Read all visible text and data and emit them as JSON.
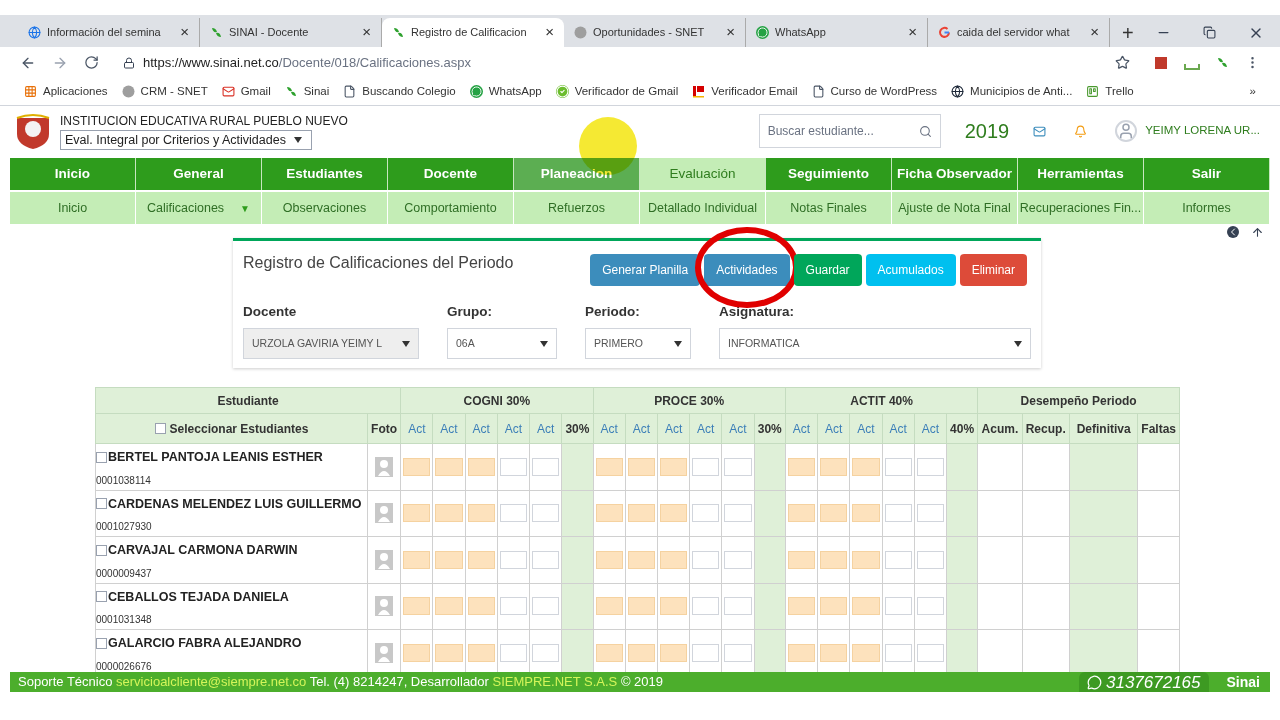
{
  "browser": {
    "tabs": [
      {
        "title": "Información del semina",
        "kind": "globe",
        "close": "×",
        "selected": false
      },
      {
        "title": "SINAI - Docente",
        "kind": "leaf",
        "close": "×",
        "selected": false
      },
      {
        "title": "Registro de Calificacion",
        "kind": "leaf",
        "close": "×",
        "selected": true
      },
      {
        "title": "Oportunidades - SNET",
        "kind": "snet",
        "close": "×",
        "selected": false
      },
      {
        "title": "WhatsApp",
        "kind": "whatsapp",
        "close": "×",
        "selected": false
      },
      {
        "title": "caida del servidor what",
        "kind": "google",
        "close": "×",
        "selected": false
      }
    ],
    "new_tab": "+",
    "url_host": "https://www.sinai.net.co",
    "url_path": "/Docente/018/Calificaciones.aspx",
    "bookmarks": [
      {
        "label": "Aplicaciones",
        "kind": "apps"
      },
      {
        "label": "CRM - SNET",
        "kind": "snet"
      },
      {
        "label": "Gmail",
        "kind": "gmail"
      },
      {
        "label": "Sinai",
        "kind": "leaf"
      },
      {
        "label": "Buscando Colegio",
        "kind": "page"
      },
      {
        "label": "WhatsApp",
        "kind": "whatsapp"
      },
      {
        "label": "Verificador de Gmail",
        "kind": "check"
      },
      {
        "label": "Verificador Email",
        "kind": "flag"
      },
      {
        "label": "Curso de WordPress",
        "kind": "page"
      },
      {
        "label": "Municipios de Anti...",
        "kind": "wiki"
      },
      {
        "label": "Trello",
        "kind": "board"
      }
    ],
    "more": "»"
  },
  "header": {
    "school": "INSTITUCION EDUCATIVA RURAL PUEBLO NUEVO",
    "evaluation_select": "Eval. Integral por Criterios y Actividades",
    "search_placeholder": "Buscar estudiante...",
    "year": "2019",
    "user": "YEIMY LORENA UR..."
  },
  "nav": [
    {
      "label": "Inicio",
      "selected": false,
      "pointer": false
    },
    {
      "label": "General",
      "selected": false,
      "pointer": false
    },
    {
      "label": "Estudiantes",
      "selected": false,
      "pointer": false
    },
    {
      "label": "Docente",
      "selected": false,
      "pointer": false
    },
    {
      "label": "Planeacion",
      "selected": false,
      "pointer": true
    },
    {
      "label": "Evaluación",
      "selected": true,
      "pointer": false
    },
    {
      "label": "Seguimiento",
      "selected": false,
      "pointer": false
    },
    {
      "label": "Ficha Observador",
      "selected": false,
      "pointer": false
    },
    {
      "label": "Herramientas",
      "selected": false,
      "pointer": false
    },
    {
      "label": "Salir",
      "selected": false,
      "pointer": false
    }
  ],
  "subnav": [
    {
      "label": "Inicio"
    },
    {
      "label": "Calificaciones",
      "caret": "▼"
    },
    {
      "label": "Observaciones"
    },
    {
      "label": "Comportamiento"
    },
    {
      "label": "Refuerzos"
    },
    {
      "label": "Detallado Individual"
    },
    {
      "label": "Notas Finales"
    },
    {
      "label": "Ajuste de Nota Final"
    },
    {
      "label": "Recuperaciones Fin..."
    },
    {
      "label": "Informes"
    }
  ],
  "form": {
    "title": "Registro de Calificaciones del Periodo",
    "buttons": [
      {
        "label": "Generar Planilla",
        "color": "#3c8dbc",
        "circled": false
      },
      {
        "label": "Actividades",
        "color": "#3c8dbc",
        "circled": true
      },
      {
        "label": "Guardar",
        "color": "#00a65a",
        "circled": false
      },
      {
        "label": "Acumulados",
        "color": "#00c0ef",
        "circled": false
      },
      {
        "label": "Eliminar",
        "color": "#dd4b39",
        "circled": false
      }
    ],
    "fields": [
      {
        "label": "Docente",
        "value": "URZOLA GAVIRIA YEIMY L",
        "disabled": true
      },
      {
        "label": "Grupo:",
        "value": "06A",
        "disabled": false
      },
      {
        "label": "Periodo:",
        "value": "PRIMERO",
        "disabled": false
      },
      {
        "label": "Asignatura:",
        "value": "INFORMATICA",
        "disabled": false
      }
    ]
  },
  "table": {
    "student_header": "Estudiante",
    "select_all": {
      "label": "Seleccionar Estudiantes",
      "checked": false
    },
    "photo_header": "Foto",
    "groups": [
      {
        "title": "COGNI 30%",
        "percent": "30%",
        "acts": [
          {
            "label": "Act",
            "filled": true
          },
          {
            "label": "Act",
            "filled": true
          },
          {
            "label": "Act",
            "filled": true
          },
          {
            "label": "Act",
            "filled": false
          },
          {
            "label": "Act",
            "filled": false
          }
        ]
      },
      {
        "title": "PROCE 30%",
        "percent": "30%",
        "acts": [
          {
            "label": "Act",
            "filled": true
          },
          {
            "label": "Act",
            "filled": true
          },
          {
            "label": "Act",
            "filled": true
          },
          {
            "label": "Act",
            "filled": false
          },
          {
            "label": "Act",
            "filled": false
          }
        ]
      },
      {
        "title": "ACTIT 40%",
        "percent": "40%",
        "acts": [
          {
            "label": "Act",
            "filled": true
          },
          {
            "label": "Act",
            "filled": true
          },
          {
            "label": "Act",
            "filled": true
          },
          {
            "label": "Act",
            "filled": false
          },
          {
            "label": "Act",
            "filled": false
          }
        ]
      }
    ],
    "performance": {
      "title": "Desempeño Periodo",
      "columns": [
        "Acum.",
        "Recup.",
        "Definitiva",
        "Faltas"
      ]
    },
    "rows": [
      {
        "name": "BERTEL PANTOJA LEANIS ESTHER",
        "code": "0001038114",
        "checked": false
      },
      {
        "name": "CARDENAS MELENDEZ LUIS GUILLERMO",
        "code": "0001027930",
        "checked": false
      },
      {
        "name": "CARVAJAL CARMONA DARWIN",
        "code": "0000009437",
        "checked": false
      },
      {
        "name": "CEBALLOS TEJADA DANIELA",
        "code": "0001031348",
        "checked": false
      },
      {
        "name": "GALARCIO FABRA ALEJANDRO",
        "code": "0000026676",
        "checked": false
      }
    ]
  },
  "footer": {
    "support": "Soporte Técnico",
    "email": "servicioalcliente@siempre.net.co",
    "phone_text": "Tel. (4) 8214247, Desarrollador",
    "developer": "SIEMPRE.NET S.A.S",
    "copyright": "© 2019",
    "whatsapp": "3137672165",
    "logo": "Sinai"
  }
}
